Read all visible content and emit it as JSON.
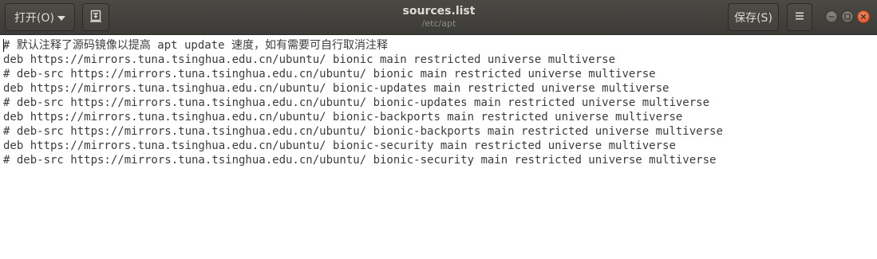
{
  "toolbar": {
    "open_label": "打开(O)",
    "save_label": "保存(S)",
    "title": "sources.list",
    "path": "/etc/apt"
  },
  "icons": {
    "open_dropdown": "chevron-down-icon",
    "pin": "pin-document-icon",
    "menu": "hamburger-menu-icon",
    "minimize": "minimize-icon",
    "maximize": "maximize-icon",
    "close": "close-icon"
  },
  "colors": {
    "titlebar": "#3c3b37",
    "close_button": "#e0502a",
    "text": "#3c3c3c"
  },
  "editor": {
    "lines": [
      "# 默认注释了源码镜像以提高 apt update 速度，如有需要可自行取消注释",
      "deb https://mirrors.tuna.tsinghua.edu.cn/ubuntu/ bionic main restricted universe multiverse",
      "# deb-src https://mirrors.tuna.tsinghua.edu.cn/ubuntu/ bionic main restricted universe multiverse",
      "deb https://mirrors.tuna.tsinghua.edu.cn/ubuntu/ bionic-updates main restricted universe multiverse",
      "# deb-src https://mirrors.tuna.tsinghua.edu.cn/ubuntu/ bionic-updates main restricted universe multiverse",
      "deb https://mirrors.tuna.tsinghua.edu.cn/ubuntu/ bionic-backports main restricted universe multiverse",
      "# deb-src https://mirrors.tuna.tsinghua.edu.cn/ubuntu/ bionic-backports main restricted universe multiverse",
      "deb https://mirrors.tuna.tsinghua.edu.cn/ubuntu/ bionic-security main restricted universe multiverse",
      "# deb-src https://mirrors.tuna.tsinghua.edu.cn/ubuntu/ bionic-security main restricted universe multiverse"
    ]
  }
}
